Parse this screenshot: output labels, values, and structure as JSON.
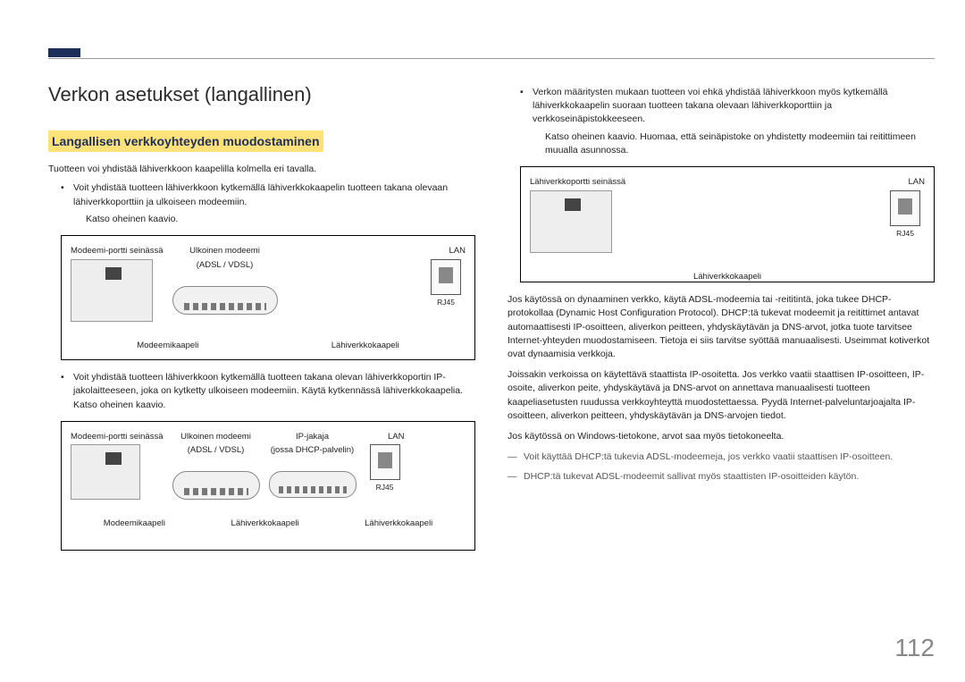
{
  "page_number": "112",
  "h1": "Verkon asetukset (langallinen)",
  "h2": "Langallisen verkkoyhteyden muodostaminen",
  "intro": "Tuotteen voi yhdistää lähiverkkoon kaapelilla kolmella eri tavalla.",
  "bullet1": "Voit yhdistää tuotteen lähiverkkoon kytkemällä lähiverkkokaapelin tuotteen takana olevaan lähiverkkoporttiin ja ulkoiseen modeemiin.",
  "bullet1_sub": "Katso oheinen kaavio.",
  "bullet2": "Voit yhdistää tuotteen lähiverkkoon kytkemällä tuotteen takana olevan lähiverkkoportin IP-jakolaitteeseen, joka on kytketty ulkoiseen modeemiin. Käytä kytkennässä lähiverkkokaapelia. Katso oheinen kaavio.",
  "bullet3": "Verkon määritysten mukaan tuotteen voi ehkä yhdistää lähiverkkoon myös kytkemällä lähiverkkokaapelin suoraan tuotteen takana olevaan lähiverkkoporttiin ja verkkoseinäpistokkeeseen.",
  "bullet3_sub": "Katso oheinen kaavio. Huomaa, että seinäpistoke on yhdistetty modeemiin tai reitittimeen muualla asunnossa.",
  "para_dhcp": "Jos käytössä on dynaaminen verkko, käytä ADSL-modeemia tai -reititintä, joka tukee DHCP-protokollaa (Dynamic Host Configuration Protocol). DHCP:tä tukevat modeemit ja reitittimet antavat automaattisesti IP-osoitteen, aliverkon peitteen, yhdyskäytävän ja DNS-arvot, jotka tuote tarvitsee Internet-yhteyden muodostamiseen. Tietoja ei siis tarvitse syöttää manuaalisesti. Useimmat kotiverkot ovat dynaamisia verkkoja.",
  "para_static": "Joissakin verkoissa on käytettävä staattista IP-osoitetta. Jos verkko vaatii staattisen IP-osoitteen, IP-osoite, aliverkon peite, yhdyskäytävä ja DNS-arvot on annettava manuaalisesti tuotteen kaapeliasetusten ruudussa verkkoyhteyttä muodostettaessa. Pyydä Internet-palveluntarjoajalta IP-osoitteen, aliverkon peitteen, yhdyskäytävän ja DNS-arvojen tiedot.",
  "para_windows": "Jos käytössä on Windows-tietokone, arvot saa myös tietokoneelta.",
  "dash1": "Voit käyttää DHCP:tä tukevia ADSL-modeemeja, jos verkko vaatii staattisen IP-osoitteen.",
  "dash2": "DHCP:tä tukevat ADSL-modeemit sallivat myös staattisten IP-osoitteiden käytön.",
  "diagram_labels": {
    "wall_modem_port": "Modeemi-portti seinässä",
    "wall_lan_port": "Lähiverkkoportti seinässä",
    "external_modem": "Ulkoinen modeemi",
    "adsl_vdsl": "(ADSL / VDSL)",
    "ip_sharer": "IP-jakaja",
    "ip_sharer_sub": "(jossa DHCP-palvelin)",
    "lan": "LAN",
    "rj45": "RJ45",
    "modem_cable": "Modeemikaapeli",
    "lan_cable": "Lähiverkkokaapeli"
  }
}
